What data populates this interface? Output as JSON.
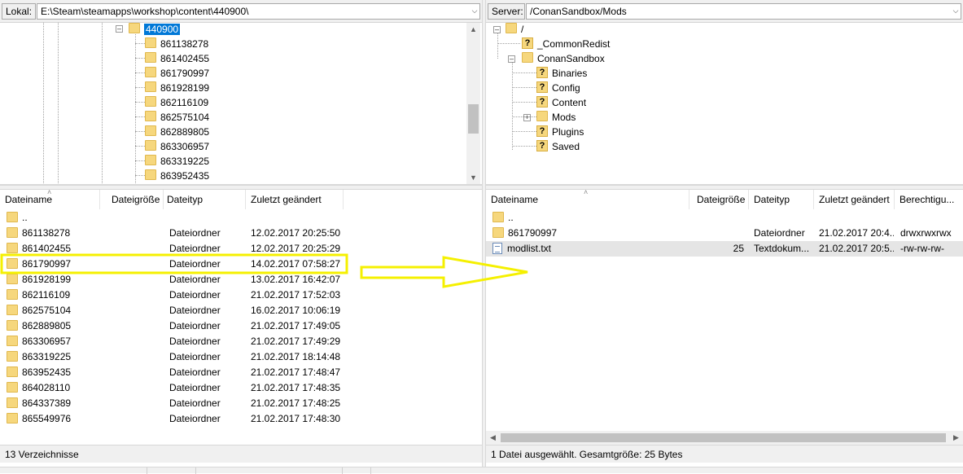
{
  "local": {
    "path_label": "Lokal:",
    "path_value": "E:\\Steam\\steamapps\\workshop\\content\\440900\\",
    "tree_selected": "440900",
    "tree_items": [
      "861138278",
      "861402455",
      "861790997",
      "861928199",
      "862116109",
      "862575104",
      "862889805",
      "863306957",
      "863319225",
      "863952435"
    ],
    "columns": [
      "Dateiname",
      "Dateigröße",
      "Dateityp",
      "Zuletzt geändert"
    ],
    "parent_entry": "..",
    "rows": [
      {
        "name": "861138278",
        "type": "Dateiordner",
        "modified": "12.02.2017 20:25:50"
      },
      {
        "name": "861402455",
        "type": "Dateiordner",
        "modified": "12.02.2017 20:25:29"
      },
      {
        "name": "861790997",
        "type": "Dateiordner",
        "modified": "14.02.2017 07:58:27"
      },
      {
        "name": "861928199",
        "type": "Dateiordner",
        "modified": "13.02.2017 16:42:07"
      },
      {
        "name": "862116109",
        "type": "Dateiordner",
        "modified": "21.02.2017 17:52:03"
      },
      {
        "name": "862575104",
        "type": "Dateiordner",
        "modified": "16.02.2017 10:06:19"
      },
      {
        "name": "862889805",
        "type": "Dateiordner",
        "modified": "21.02.2017 17:49:05"
      },
      {
        "name": "863306957",
        "type": "Dateiordner",
        "modified": "21.02.2017 17:49:29"
      },
      {
        "name": "863319225",
        "type": "Dateiordner",
        "modified": "21.02.2017 18:14:48"
      },
      {
        "name": "863952435",
        "type": "Dateiordner",
        "modified": "21.02.2017 17:48:47"
      },
      {
        "name": "864028110",
        "type": "Dateiordner",
        "modified": "21.02.2017 17:48:35"
      },
      {
        "name": "864337389",
        "type": "Dateiordner",
        "modified": "21.02.2017 17:48:25"
      },
      {
        "name": "865549976",
        "type": "Dateiordner",
        "modified": "21.02.2017 17:48:30"
      }
    ],
    "status": "13 Verzeichnisse"
  },
  "remote": {
    "path_label": "Server:",
    "path_value": "/ConanSandbox/Mods",
    "tree_root": "/",
    "tree_common": "_CommonRedist",
    "tree_sandbox": "ConanSandbox",
    "tree_children": [
      "Binaries",
      "Config",
      "Content",
      "Mods",
      "Plugins",
      "Saved"
    ],
    "columns": [
      "Dateiname",
      "Dateigröße",
      "Dateityp",
      "Zuletzt geändert",
      "Berechtigu..."
    ],
    "parent_entry": "..",
    "rows": [
      {
        "name": "861790997",
        "size": "",
        "type": "Dateiordner",
        "modified": "21.02.2017 20:4...",
        "perms": "drwxrwxrwx",
        "icon": "folder"
      },
      {
        "name": "modlist.txt",
        "size": "25",
        "type": "Textdokum...",
        "modified": "21.02.2017 20:5...",
        "perms": "-rw-rw-rw-",
        "icon": "text-file"
      }
    ],
    "status": "1 Datei ausgewählt. Gesamtgröße: 25 Bytes"
  },
  "annotation": {
    "color": "#f5f000",
    "highlighted_row": "861790997"
  }
}
